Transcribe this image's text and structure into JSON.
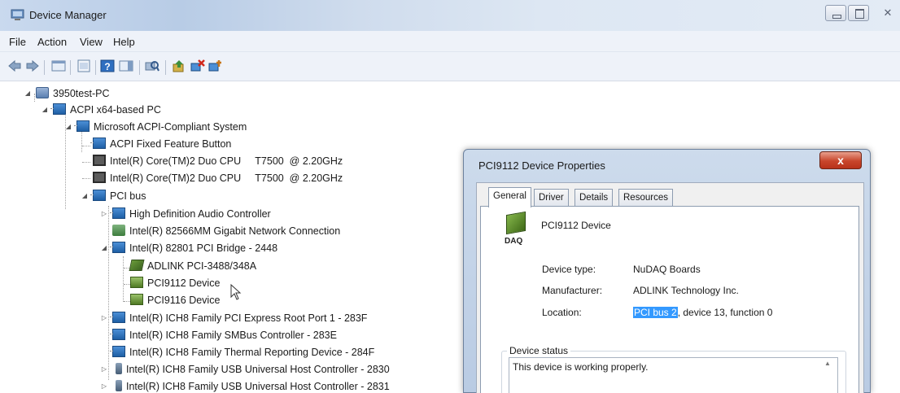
{
  "window": {
    "title": "Device Manager",
    "close_glyph": "✕"
  },
  "menu": [
    "File",
    "Action",
    "View",
    "Help"
  ],
  "toolbar": {
    "icons": [
      "back-arrow-icon",
      "forward-arrow-icon",
      "show-hide-console-icon",
      "properties-icon",
      "help-icon",
      "action-pane-icon",
      "scan-hardware-icon",
      "update-driver-icon",
      "uninstall-device-icon",
      "disable-device-icon"
    ]
  },
  "tree": {
    "items": [
      {
        "label": "3950test-PC",
        "icon": "computer-icon"
      },
      {
        "label": "ACPI x64-based PC",
        "icon": "system-board-icon"
      },
      {
        "label": "Microsoft ACPI-Compliant System",
        "icon": "system-board-icon"
      },
      {
        "label": "ACPI Fixed Feature Button",
        "icon": "system-board-icon"
      },
      {
        "label": "Intel(R) Core(TM)2 Duo CPU     T7500  @ 2.20GHz",
        "icon": "processor-icon"
      },
      {
        "label": "Intel(R) Core(TM)2 Duo CPU     T7500  @ 2.20GHz",
        "icon": "processor-icon"
      },
      {
        "label": "PCI bus",
        "icon": "system-board-icon"
      },
      {
        "label": "High Definition Audio Controller",
        "icon": "system-board-icon"
      },
      {
        "label": "Intel(R) 82566MM Gigabit Network Connection",
        "icon": "network-adapter-icon"
      },
      {
        "label": "Intel(R) 82801 PCI Bridge - 2448",
        "icon": "system-board-icon"
      },
      {
        "label": "ADLINK PCI-3488/348A",
        "icon": "adlink-card-icon"
      },
      {
        "label": "PCI9112 Device",
        "icon": "daq-card-icon"
      },
      {
        "label": "PCI9116 Device",
        "icon": "daq-card-icon"
      },
      {
        "label": "Intel(R) ICH8 Family PCI Express Root Port 1 - 283F",
        "icon": "system-board-icon"
      },
      {
        "label": "Intel(R) ICH8 Family SMBus Controller - 283E",
        "icon": "system-board-icon"
      },
      {
        "label": "Intel(R) ICH8 Family Thermal Reporting Device - 284F",
        "icon": "system-board-icon"
      },
      {
        "label": "Intel(R) ICH8 Family USB Universal Host Controller - 2830",
        "icon": "usb-icon"
      },
      {
        "label": "Intel(R) ICH8 Family USB Universal Host Controller - 2831",
        "icon": "usb-icon"
      }
    ]
  },
  "dialog": {
    "title": "PCI9112 Device Properties",
    "close_glyph": "x",
    "tabs": [
      "General",
      "Driver",
      "Details",
      "Resources"
    ],
    "active_tab": "General",
    "device_name": "PCI9112 Device",
    "icon_label": "DAQ",
    "properties": {
      "type_label": "Device type:",
      "type_value": "NuDAQ Boards",
      "manufacturer_label": "Manufacturer:",
      "manufacturer_value": "ADLINK Technology Inc.",
      "location_label": "Location:",
      "location_selected": "PCI bus 2",
      "location_rest": ", device 13, function 0"
    },
    "status_group_label": "Device status",
    "status_text": "This device is working properly."
  }
}
